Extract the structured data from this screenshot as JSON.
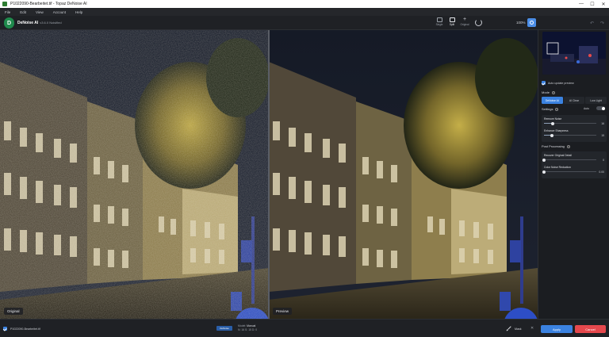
{
  "window": {
    "title": "P1022090-Bearbeitet.tif - Topaz DeNoise AI",
    "controls": [
      "—",
      "☐",
      "✕"
    ]
  },
  "menu": [
    "File",
    "Edit",
    "View",
    "Account",
    "Help"
  ],
  "toolbar": {
    "app_name": "DeNoise AI",
    "version": "v3.6.0 Noisified",
    "views": [
      {
        "label": "Single",
        "icon": "single-view-icon"
      },
      {
        "label": "Split",
        "icon": "split-view-icon"
      },
      {
        "label": "Original",
        "icon": "original-view-icon"
      }
    ],
    "zoom": "100%"
  },
  "viewport": {
    "left_label": "Original",
    "right_label": "Preview"
  },
  "panel": {
    "auto_update": "Auto update preview",
    "mode_heading": "Mode",
    "modes": [
      "DeNoise AI",
      "AI Clear",
      "Low Light"
    ],
    "active_mode": "DeNoise AI",
    "settings_heading": "Settings",
    "auto_label": "Auto",
    "sliders": [
      {
        "label": "Remove Noise",
        "value": "16",
        "level": 0.16
      },
      {
        "label": "Enhance Sharpness",
        "value": "15",
        "level": 0.15
      }
    ],
    "post_heading": "Post Processing",
    "post_sliders": [
      {
        "label": "Recover Original Detail",
        "value": "0",
        "level": 0.0
      },
      {
        "label": "Color Noise Reduction",
        "value": "0.00",
        "level": 0.0
      }
    ]
  },
  "bottom": {
    "filename": "P1022090-Bearbeitet.tif",
    "mode_tag": "DeNoise",
    "model_label": "Model:",
    "model_value": "Manual",
    "params": "N: 16   S: 15   D: 0",
    "mask": "Mask",
    "apply": "Apply",
    "cancel": "Cancel",
    "close": "✕"
  },
  "colors": {
    "accent": "#3b82e0",
    "cancel": "#e5484d",
    "brand": "#1f8a4c"
  }
}
